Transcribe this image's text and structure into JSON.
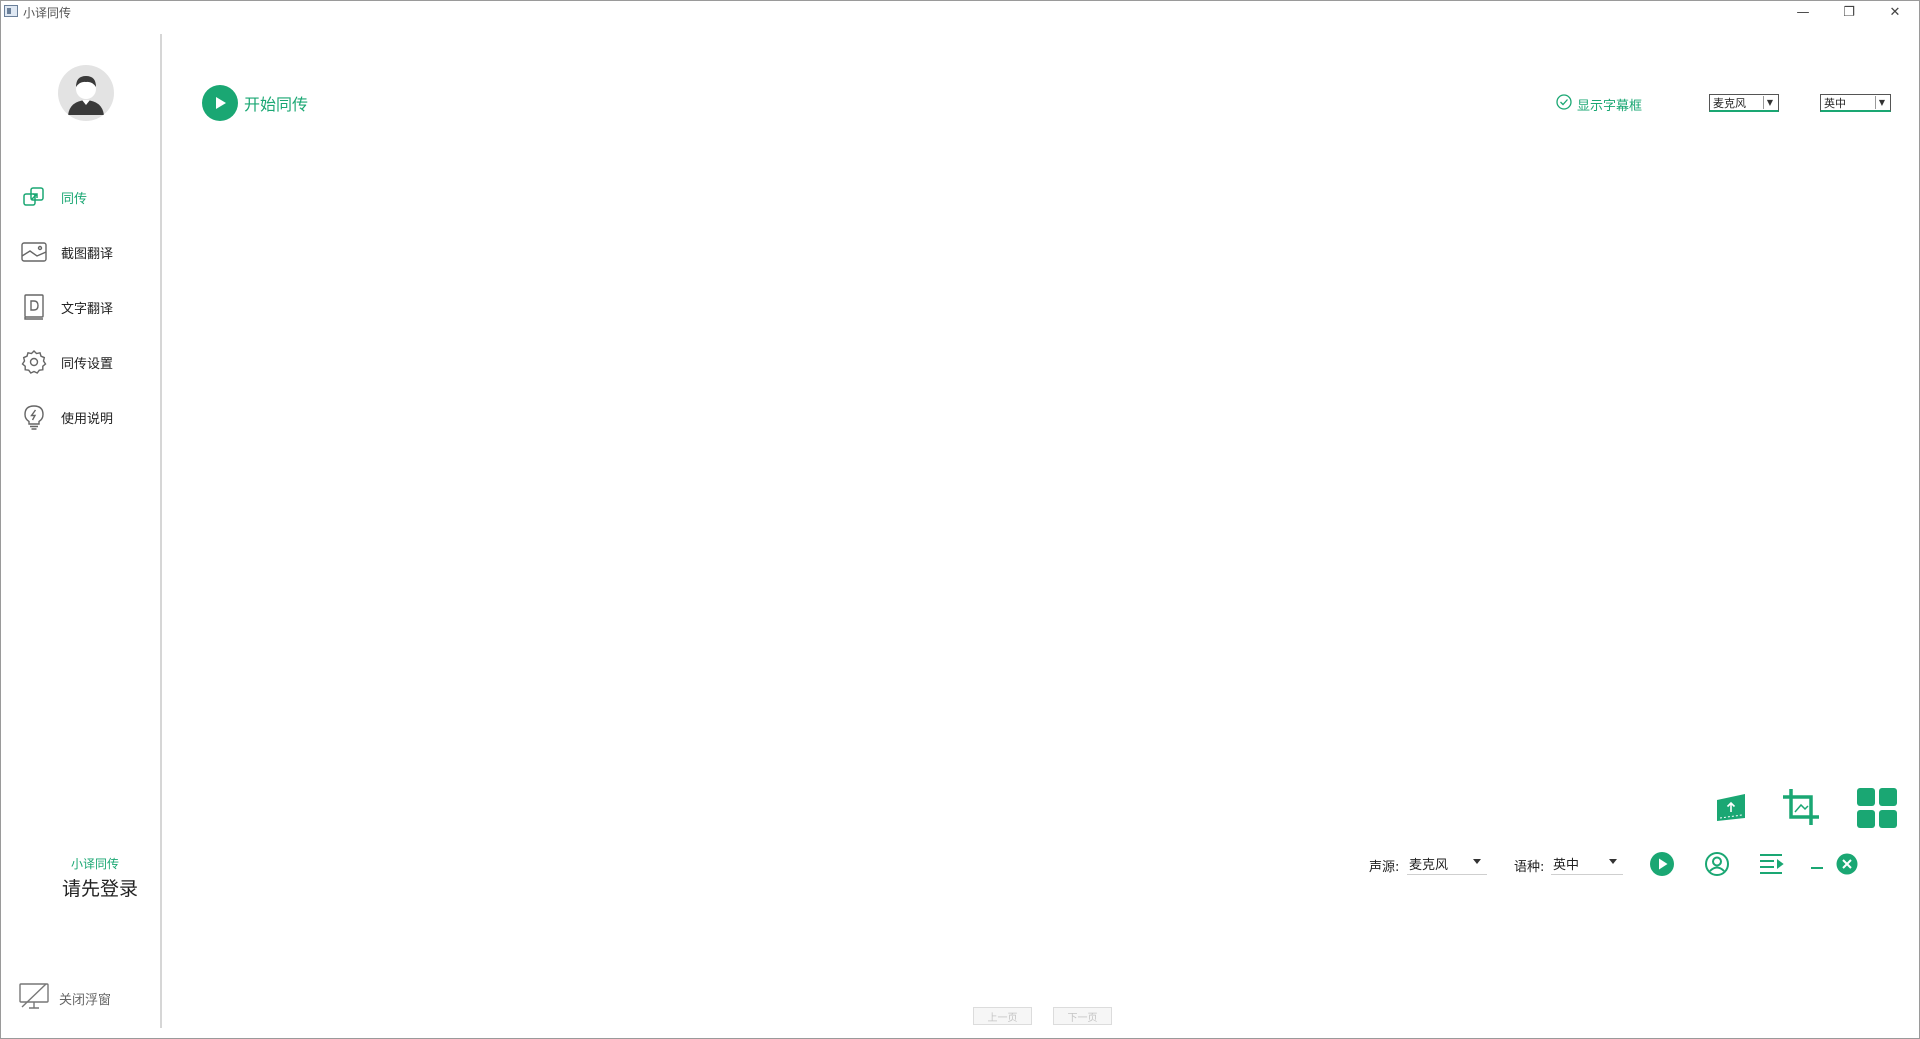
{
  "window": {
    "title": "小译同传",
    "controls": {
      "minimize": "—",
      "maximize": "❐",
      "close": "✕"
    }
  },
  "sidebar": {
    "items": [
      {
        "label": "同传",
        "icon": "share-screen-icon",
        "active": true
      },
      {
        "label": "截图翻译",
        "icon": "image-icon",
        "active": false
      },
      {
        "label": "文字翻译",
        "icon": "document-icon",
        "active": false
      },
      {
        "label": "同传设置",
        "icon": "gear-icon",
        "active": false
      },
      {
        "label": "使用说明",
        "icon": "lightbulb-icon",
        "active": false
      }
    ],
    "brand": "小译同传",
    "login": "请先登录",
    "close_float": "关闭浮窗"
  },
  "main": {
    "start_label": "开始同传",
    "show_subtitle_label": "显示字幕框",
    "top_source_value": "麦克风",
    "top_lang_value": "英中"
  },
  "floating_bar": {
    "source_label": "声源:",
    "source_value": "麦克风",
    "lang_label": "语种:",
    "lang_value": "英中"
  },
  "pager": {
    "prev": "上一页",
    "next": "下一页"
  },
  "colors": {
    "accent": "#1aa773"
  }
}
